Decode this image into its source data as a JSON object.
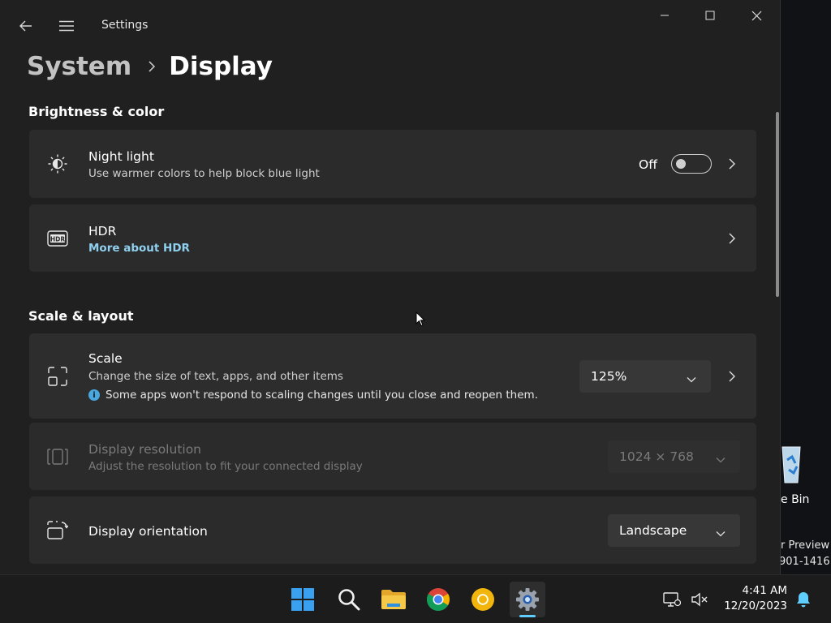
{
  "window": {
    "app_title": "Settings",
    "breadcrumb": {
      "parent": "System",
      "current": "Display"
    }
  },
  "sections": {
    "brightness": "Brightness & color",
    "scale_layout": "Scale & layout"
  },
  "night_light": {
    "title": "Night light",
    "subtitle": "Use warmer colors to help block blue light",
    "state_label": "Off"
  },
  "hdr": {
    "title": "HDR",
    "link": "More about HDR"
  },
  "scale": {
    "title": "Scale",
    "subtitle": "Change the size of text, apps, and other items",
    "info": "Some apps won't respond to scaling changes until you close and reopen them.",
    "value": "125%"
  },
  "resolution": {
    "title": "Display resolution",
    "subtitle": "Adjust the resolution to fit your connected display",
    "value": "1024 × 768"
  },
  "orientation": {
    "title": "Display orientation",
    "value": "Landscape"
  },
  "desktop": {
    "recycle_label": "e Bin",
    "watermark_line1": "r Preview",
    "watermark_line2": "901-1416"
  },
  "taskbar": {
    "time": "4:41 AM",
    "date": "12/20/2023"
  },
  "colors": {
    "accent": "#60cdff",
    "link": "#8fd0ef",
    "card": "#2b2b2b",
    "window": "#202020"
  }
}
